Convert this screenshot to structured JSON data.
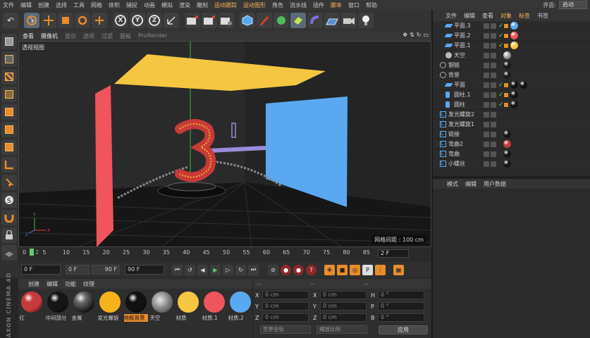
{
  "menu": {
    "items": [
      "文件",
      "编辑",
      "创建",
      "选择",
      "工具",
      "网格",
      "体积",
      "捕捉",
      "动画",
      "模拟",
      "渲染",
      "雕刻",
      "运动跟踪",
      "运动图形",
      "角色",
      "流水线",
      "插件",
      "脚本",
      "窗口",
      "帮助"
    ],
    "highlighted": [
      "运动跟踪",
      "运动图形",
      "脚本"
    ],
    "layout_label": "界面:",
    "layout_value": "启动"
  },
  "viewport": {
    "menu": [
      "查看",
      "摄像机",
      "显示",
      "选项",
      "过滤",
      "面板",
      "ProRender"
    ],
    "label": "透视视图",
    "grid_info": "网格间距 : 100 cm"
  },
  "timeline": {
    "ticks": [
      "0",
      "5",
      "10",
      "15",
      "20",
      "25",
      "30",
      "35",
      "40",
      "45",
      "50",
      "55",
      "60",
      "65",
      "70",
      "75",
      "80",
      "85",
      "90"
    ],
    "playhead_label": "2",
    "end_field": "2 F"
  },
  "transport": {
    "start": "0 F",
    "min": "0 F",
    "max": "90 F",
    "end": "90 F"
  },
  "materials": {
    "menu": [
      "创建",
      "编辑",
      "功能",
      "纹理"
    ],
    "items": [
      {
        "name": "红",
        "color": "#c83a3a",
        "type": "glossy"
      },
      {
        "name": "中间部分",
        "color": "#151515",
        "type": "glossy"
      },
      {
        "name": "金属",
        "color": "#1e1e1e",
        "type": "metal"
      },
      {
        "name": "发光螺旋",
        "color": "#f5b319",
        "type": "flat"
      },
      {
        "name": "地板背景",
        "color": "#111111",
        "type": "glossy",
        "selected": true
      },
      {
        "name": "天空",
        "color": "#8a8a8a",
        "type": "env"
      },
      {
        "name": "材质",
        "color": "#f5c641",
        "type": "flat"
      },
      {
        "name": "材质.1",
        "color": "#f0545c",
        "type": "flat"
      },
      {
        "name": "材质.2",
        "color": "#5aa9f0",
        "type": "flat"
      }
    ]
  },
  "coords": {
    "header": [
      "--",
      "--",
      "--"
    ],
    "rows": [
      {
        "a": "X",
        "av": "0 cm",
        "b": "X",
        "bv": "0 cm",
        "c": "H",
        "cv": "0 °"
      },
      {
        "a": "Y",
        "av": "0 cm",
        "b": "Y",
        "bv": "0 cm",
        "c": "P",
        "cv": "0 °"
      },
      {
        "a": "Z",
        "av": "0 cm",
        "b": "Z",
        "bv": "0 cm",
        "c": "B",
        "cv": "0 °"
      }
    ],
    "coord_system": "世界坐标",
    "scale_mode": "缩放比例",
    "apply": "应用"
  },
  "objects": {
    "menu": [
      "文件",
      "编辑",
      "查看",
      "对象",
      "标签",
      "书签"
    ],
    "highlighted": [
      "对象",
      "标签"
    ],
    "items": [
      {
        "name": "平面.3",
        "indent": 1,
        "icon": "plane",
        "check": true,
        "tags": [
          "phong",
          "dot"
        ],
        "dot": "#5aa9f0"
      },
      {
        "name": "平面.2",
        "indent": 1,
        "icon": "plane",
        "check": true,
        "tags": [
          "phong",
          "dot"
        ],
        "dot": "#f0545c"
      },
      {
        "name": "平面.1",
        "indent": 1,
        "icon": "plane",
        "check": true,
        "tags": [
          "phong",
          "dot"
        ],
        "dot": "#f5c641"
      },
      {
        "name": "天空",
        "indent": 1,
        "icon": "sky",
        "check": false,
        "tags": [
          "env"
        ],
        "dot": "#8a8a8a"
      },
      {
        "name": "钢链",
        "indent": 0,
        "icon": "null",
        "check": false,
        "tags": [
          "dot"
        ],
        "dot": "#1a1a1a"
      },
      {
        "name": "背景",
        "indent": 0,
        "icon": "null",
        "check": false,
        "tags": [
          "dot"
        ],
        "dot": "#1a1a1a"
      },
      {
        "name": "平面",
        "indent": 1,
        "icon": "plane",
        "check": true,
        "tags": [
          "phong",
          "dot",
          "dot2"
        ],
        "dot": "#111111"
      },
      {
        "name": "圆柱.1",
        "indent": 1,
        "icon": "cyl",
        "check": true,
        "tags": [
          "phong",
          "dot"
        ],
        "dot": "#151515"
      },
      {
        "name": "圆柱",
        "indent": 1,
        "icon": "cyl",
        "check": true,
        "tags": [
          "phong",
          "dot"
        ],
        "dot": "#151515"
      },
      {
        "name": "发光螺旋2",
        "indent": 0,
        "icon": "lo",
        "check": false,
        "tags": [],
        "dot": ""
      },
      {
        "name": "发光螺旋1",
        "indent": 0,
        "icon": "lo",
        "check": false,
        "tags": [],
        "dot": ""
      },
      {
        "name": "链接",
        "indent": 0,
        "icon": "lo",
        "check": false,
        "tags": [
          "dot"
        ],
        "dot": "#151515"
      },
      {
        "name": "弯曲2",
        "indent": 0,
        "icon": "lo",
        "check": false,
        "tags": [
          "dot"
        ],
        "dot": "#c83a3a"
      },
      {
        "name": "弯曲",
        "indent": 0,
        "icon": "lo",
        "check": false,
        "tags": [
          "dot"
        ],
        "dot": "#151515"
      },
      {
        "name": "小螺丝",
        "indent": 0,
        "icon": "lo",
        "check": false,
        "tags": [
          "dot"
        ],
        "dot": "#151515"
      }
    ]
  },
  "attributes": {
    "menu": [
      "模式",
      "编辑",
      "用户数据"
    ]
  },
  "brand": {
    "maxon": "MAXON CINEMA 4D"
  }
}
